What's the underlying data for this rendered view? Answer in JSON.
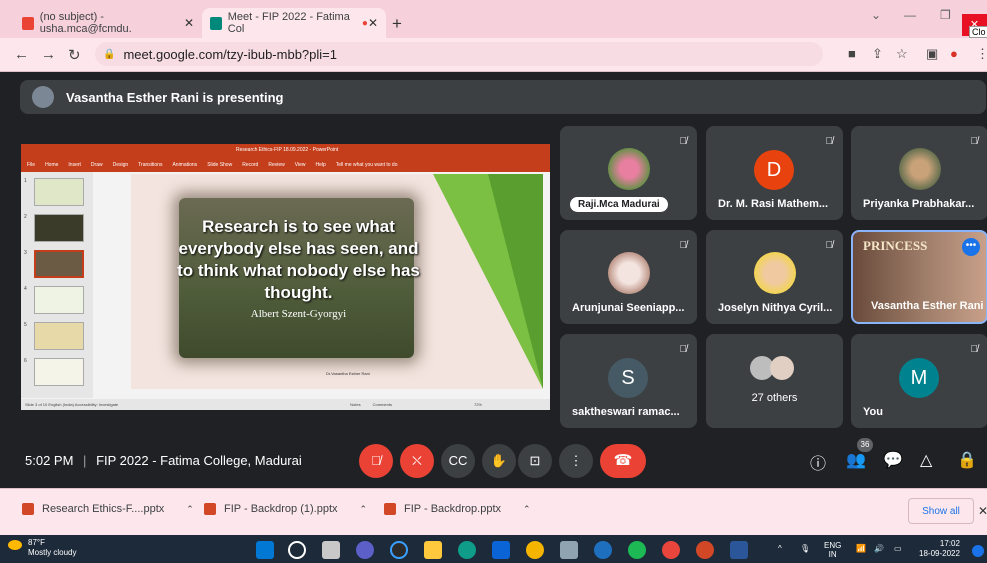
{
  "browser": {
    "tabs": [
      {
        "label": "(no subject) - usha.mca@fcmdu.",
        "favicon_color": "#ea4335"
      },
      {
        "label": "Meet - FIP 2022 - Fatima Col",
        "favicon_color": "#00897b"
      }
    ],
    "new_tab": "+",
    "url": "meet.google.com/tzy-ibub-mbb?pli=1",
    "close_tooltip": "Clo"
  },
  "meet": {
    "presenting_text": "Vasantha Esther Rani is presenting",
    "meeting_time": "5:02 PM",
    "meeting_separator": "|",
    "meeting_name": "FIP 2022 - Fatima College, Madurai",
    "people_count": "36",
    "participants": [
      {
        "name": "Raji.Mca Madurai",
        "muted": true,
        "avatar": "flowers-photo"
      },
      {
        "name": "Dr. M. Rasi Mathem...",
        "muted": true,
        "letter": "D",
        "color": "#e8430f"
      },
      {
        "name": "Priyanka Prabhakar...",
        "muted": true,
        "avatar": "couple-photo"
      },
      {
        "name": "Arunjunai Seeniapp...",
        "muted": true,
        "avatar": "girl-photo"
      },
      {
        "name": "Joselyn Nithya Cyril...",
        "muted": true,
        "avatar": "woman-photo"
      },
      {
        "name": "Vasantha Esther Rani",
        "muted": false,
        "video": true,
        "overlay_text": "PRINCESS"
      },
      {
        "name": "saktheswari ramac...",
        "muted": true,
        "letter": "S",
        "color": "#455a64"
      },
      {
        "name": "27 others",
        "muted": false,
        "avatar": "group-avatars"
      },
      {
        "name": "You",
        "muted": true,
        "letter": "M",
        "color": "#00838f"
      }
    ]
  },
  "slide": {
    "window_title": "Research Ethics-FIP 18.09.2022 - PowerPoint",
    "menu": [
      "File",
      "Home",
      "Insert",
      "Draw",
      "Design",
      "Transitions",
      "Animations",
      "Slide Show",
      "Record",
      "Review",
      "View",
      "Help",
      "Tell me what you want to do"
    ],
    "quote": "Research is to see what everybody else has seen, and to think what nobody else has thought.",
    "author": "Albert Szent-Gyorgyi",
    "footer": "Dr.Vasantha Esther Rani",
    "slide_numbers": [
      "1",
      "2",
      "3",
      "4",
      "5",
      "6"
    ],
    "status": "Slide 3 of 10   English (India)   Accessibility: Investigate",
    "notes": "Notes",
    "comments": "Comments",
    "zoom": "72%"
  },
  "downloads": [
    {
      "name": "Research Ethics-F....pptx"
    },
    {
      "name": "FIP - Backdrop (1).pptx"
    },
    {
      "name": "FIP - Backdrop.pptx"
    }
  ],
  "show_all": "Show all",
  "taskbar": {
    "temp": "87°F",
    "weather": "Mostly cloudy",
    "lang": "ENG",
    "region": "IN",
    "time": "17:02",
    "date": "18-09-2022"
  }
}
